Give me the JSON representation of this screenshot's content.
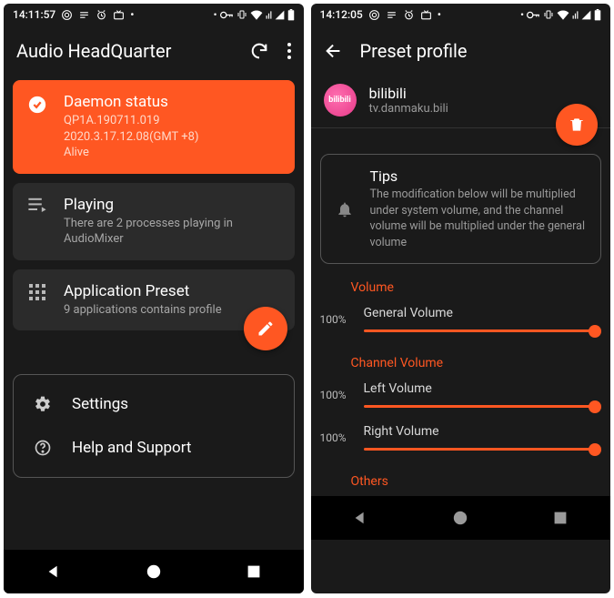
{
  "colors": {
    "accent": "#ff5722",
    "card": "#2b2b2b",
    "bg": "#1a1a1a"
  },
  "screen1": {
    "status_time": "14:11:57",
    "app_title": "Audio HeadQuarter",
    "daemon": {
      "title": "Daemon status",
      "line1": "QP1A.190711.019",
      "line2": "2020.3.17.12.08(GMT +8)",
      "state": "Alive"
    },
    "playing": {
      "title": "Playing",
      "sub": "There are 2 processes playing in AudioMixer"
    },
    "preset": {
      "title": "Application Preset",
      "sub": "9 applications contains profile"
    },
    "settings_label": "Settings",
    "help_label": "Help and Support"
  },
  "screen2": {
    "status_time": "14:12:05",
    "app_title": "Preset profile",
    "profile": {
      "name": "bilibili",
      "package": "tv.danmaku.bili",
      "avatar_text": "bilibili"
    },
    "tips": {
      "title": "Tips",
      "body": "The modification below will be multiplied under system volume, and the channel volume will be multiplied under the general volume"
    },
    "sections": {
      "volume": {
        "label": "Volume",
        "general": {
          "label": "General Volume",
          "value": "100%"
        }
      },
      "channel": {
        "label": "Channel Volume",
        "left": {
          "label": "Left Volume",
          "value": "100%"
        },
        "right": {
          "label": "Right Volume",
          "value": "100%"
        }
      },
      "others_label": "Others"
    }
  }
}
